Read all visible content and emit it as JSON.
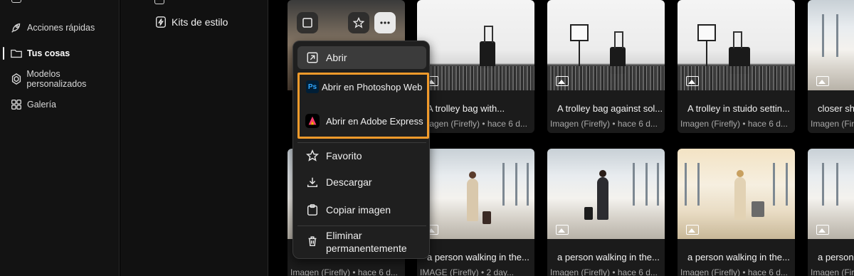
{
  "nav": {
    "items": [
      {
        "label": "Acciones rápidas",
        "icon": "rocket-icon"
      },
      {
        "label": "Tus cosas",
        "icon": "folder-icon",
        "active": true
      },
      {
        "label": "Modelos personalizados",
        "icon": "custom-models-icon"
      },
      {
        "label": "Galería",
        "icon": "gallery-grid-icon"
      }
    ]
  },
  "panel": {
    "items": [
      {
        "label": "Kits de estilo",
        "icon": "style-kit-icon"
      }
    ]
  },
  "grid": {
    "cards": [
      {
        "title": "",
        "meta": ""
      },
      {
        "title": "A trolley bag with...",
        "meta": "Imagen (Firefly) • hace 6 d..."
      },
      {
        "title": "A trolley bag against sol...",
        "meta": "Imagen (Firefly) • hace 6 d..."
      },
      {
        "title": "A trolley in stuido settin...",
        "meta": "Imagen (Firefly) • hace 6 d..."
      },
      {
        "title": "closer shot",
        "meta": "Imagen (Firefly)"
      },
      {
        "title": "",
        "meta": "Imagen (Firefly) • hace 6 d..."
      },
      {
        "title": "a person walking in the...",
        "meta": "IMAGE (Firefly) • 2 day..."
      },
      {
        "title": "a person walking in the...",
        "meta": "Imagen (Firefly) • hace 6 d..."
      },
      {
        "title": "a person walking in the...",
        "meta": "Imagen (Firefly) • hace 6 d..."
      },
      {
        "title": "a person walking",
        "meta": "Imagen (Firefly)"
      }
    ]
  },
  "overlay": {
    "checkbox_icon": "checkbox-icon",
    "favorite_icon": "star-icon",
    "more_icon": "more-icon"
  },
  "menu": {
    "items": [
      {
        "label": "Abrir",
        "icon": "open-external-icon"
      },
      {
        "label": "Abrir en Photoshop Web",
        "icon": "photoshop-icon"
      },
      {
        "label": "Abrir en Adobe Express",
        "icon": "adobe-express-icon"
      },
      {
        "label": "Favorito",
        "icon": "star-icon"
      },
      {
        "label": "Descargar",
        "icon": "download-icon"
      },
      {
        "label": "Copiar imagen",
        "icon": "copy-image-icon"
      },
      {
        "label": "Eliminar permanentemente",
        "icon": "trash-icon"
      }
    ],
    "photoshop_badge": "Ps"
  },
  "colors": {
    "highlight": "#f09a2b",
    "background": "#000000",
    "caption_bg": "#1b1b1b"
  }
}
